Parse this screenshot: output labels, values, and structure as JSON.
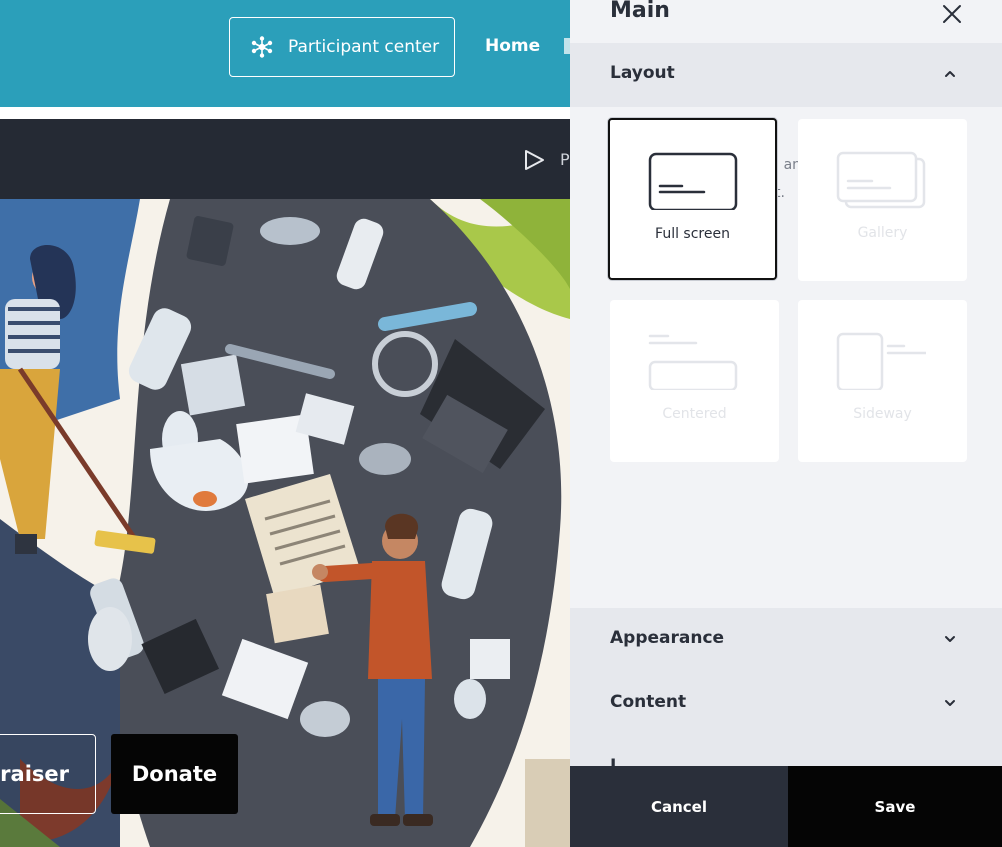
{
  "site": {
    "header_color": "#2b9fba",
    "participant_center_label": "Participant center",
    "participant_center_icon": "network-icon",
    "nav_home": "Home",
    "toolbar_play_icon": "play-icon",
    "toolbar_letter": "P",
    "hero_image": "waste-illustration",
    "fundraiser_label": "draiser",
    "donate_label": "Donate"
  },
  "panel": {
    "title": "Main",
    "close_icon": "close-icon",
    "sections": {
      "layout": "Layout",
      "appearance": "Appearance",
      "content": "Content",
      "partial": "L"
    },
    "hint": "You may need to upload and crop the image again if you change the layout.",
    "layouts": [
      {
        "label": "Full screen",
        "selected": true
      },
      {
        "label": "Gallery",
        "selected": false
      },
      {
        "label": "Centered",
        "selected": false
      },
      {
        "label": "Sideway",
        "selected": false
      }
    ],
    "cancel_label": "Cancel",
    "save_label": "Save"
  },
  "colors": {
    "accent": "#2b9fba",
    "dark": "#252a34",
    "panel_bg": "#f2f3f6",
    "black": "#050505"
  }
}
